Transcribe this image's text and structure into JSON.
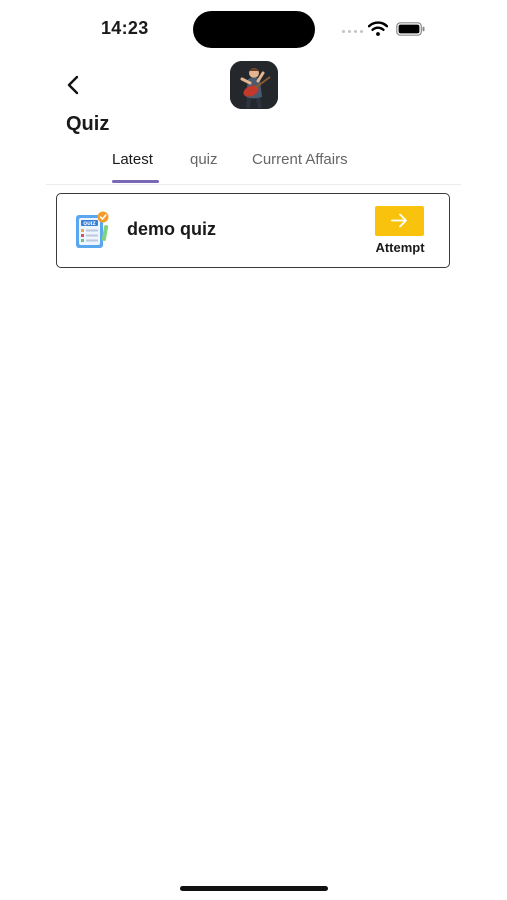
{
  "status_bar": {
    "time": "14:23",
    "signal_icon": "cellular-dots-icon",
    "wifi_icon": "wifi-icon",
    "battery_icon": "battery-icon"
  },
  "header": {
    "back_icon": "chevron-left-icon",
    "app_avatar": "guitarist-avatar-icon",
    "title": "Quiz"
  },
  "tabs": [
    {
      "label": "Latest",
      "active": true
    },
    {
      "label": "quiz",
      "active": false
    },
    {
      "label": "Current Affairs",
      "active": false
    }
  ],
  "quizzes": [
    {
      "name": "demo quiz",
      "icon": "quiz-sheet-icon",
      "action_label": "Attempt",
      "action_icon": "arrow-right-icon"
    }
  ],
  "colors": {
    "accent": "#f8c20d",
    "tab_indicator": "#7a67b5",
    "background": "#ffffff"
  }
}
